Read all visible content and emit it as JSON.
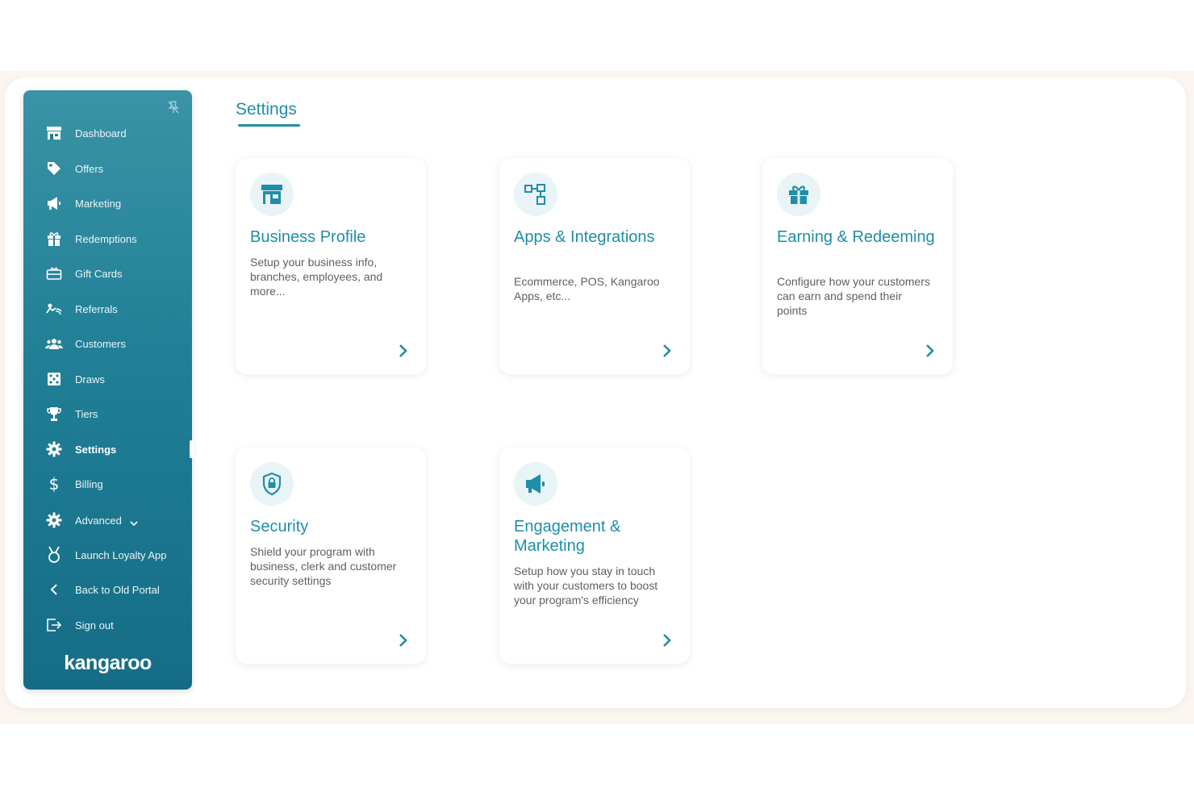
{
  "colors": {
    "accent": "#1f8ea8",
    "sidebar_top": "#3a93a6",
    "sidebar_bottom": "#156c86",
    "icon_bg": "#e9f4f7",
    "desc_text": "#5b6166"
  },
  "sidebar": {
    "pin_icon": "unpin-icon",
    "items": [
      {
        "label": "Dashboard",
        "icon": "store-icon"
      },
      {
        "label": "Offers",
        "icon": "tag-icon"
      },
      {
        "label": "Marketing",
        "icon": "megaphone-icon"
      },
      {
        "label": "Redemptions",
        "icon": "gift-icon"
      },
      {
        "label": "Gift Cards",
        "icon": "gift-card-icon"
      },
      {
        "label": "Referrals",
        "icon": "referral-icon"
      },
      {
        "label": "Customers",
        "icon": "users-icon"
      },
      {
        "label": "Draws",
        "icon": "dice-icon"
      },
      {
        "label": "Tiers",
        "icon": "trophy-icon"
      },
      {
        "label": "Settings",
        "icon": "gear-icon",
        "active": true
      },
      {
        "label": "Billing",
        "icon": "dollar-icon"
      },
      {
        "label": "Advanced",
        "icon": "gear-icon"
      },
      {
        "label": "Launch Loyalty App",
        "icon": "medal-icon"
      },
      {
        "label": "Back to Old Portal",
        "icon": "chevron-left-icon"
      },
      {
        "label": "Sign out",
        "icon": "sign-out-icon"
      }
    ],
    "brand": "kangaroo"
  },
  "main": {
    "title": "Settings",
    "cards": [
      {
        "title": "Business Profile",
        "description": "Setup your business info, branches, employees, and more...",
        "icon": "store-icon"
      },
      {
        "title": "Apps & Integrations",
        "description": "Ecommerce, POS, Kangaroo Apps, etc...",
        "icon": "integrations-icon"
      },
      {
        "title": "Earning & Redeeming",
        "description": "Configure how your customers can earn and spend their points",
        "icon": "gift-icon"
      },
      {
        "title": "Security",
        "description": "Shield your program with business, clerk and customer security settings",
        "icon": "shield-lock-icon"
      },
      {
        "title": "Engagement & Marketing",
        "description": "Setup how you stay in touch with your customers to boost your program's efficiency",
        "icon": "megaphone-icon"
      }
    ]
  }
}
